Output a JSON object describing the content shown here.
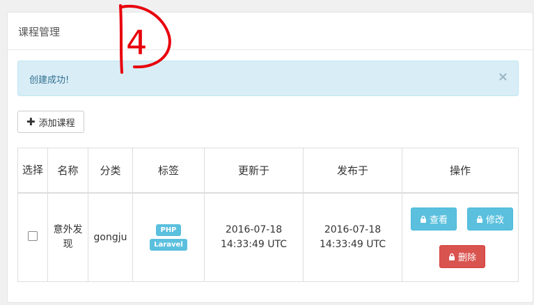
{
  "panel": {
    "title": "课程管理"
  },
  "annotation": {
    "text": "4"
  },
  "alert": {
    "message": "创建成功!",
    "close": "×"
  },
  "toolbar": {
    "add_label": "添加课程",
    "add_icon": "plus-icon"
  },
  "table": {
    "headers": [
      "选择",
      "名称",
      "分类",
      "标签",
      "更新于",
      "发布于",
      "操作"
    ],
    "rows": [
      {
        "name": "意外发现",
        "category": "gongju",
        "tags": [
          "PHP",
          "Laravel"
        ],
        "updated": "2016-07-18 14:33:49 UTC",
        "published": "2016-07-18 14:33:49 UTC",
        "actions": {
          "view": "查看",
          "edit": "修改",
          "delete": "删除"
        }
      }
    ]
  },
  "colors": {
    "info": "#5bc0de",
    "danger": "#d9534f",
    "alert_bg": "#d9edf7",
    "alert_text": "#31708f",
    "annotation": "#e8000b"
  }
}
